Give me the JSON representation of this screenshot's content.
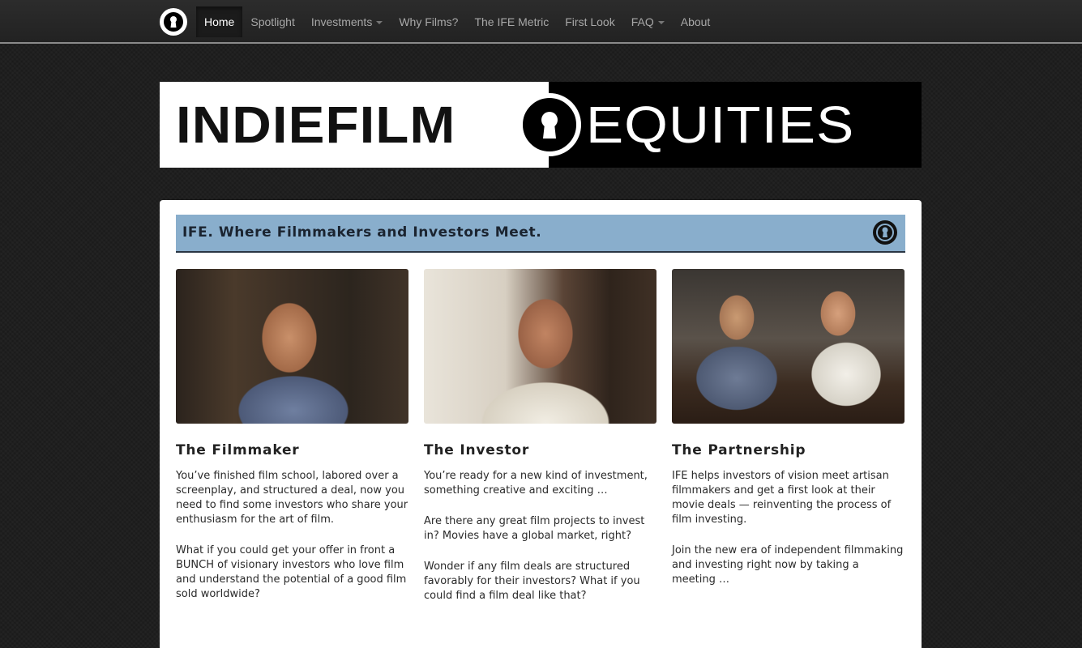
{
  "nav": {
    "brand_icon": "keyhole-icon",
    "items": [
      {
        "label": "Home",
        "active": true,
        "dropdown": false
      },
      {
        "label": "Spotlight",
        "active": false,
        "dropdown": false
      },
      {
        "label": "Investments",
        "active": false,
        "dropdown": true
      },
      {
        "label": "Why Films?",
        "active": false,
        "dropdown": false
      },
      {
        "label": "The IFE Metric",
        "active": false,
        "dropdown": false
      },
      {
        "label": "First Look",
        "active": false,
        "dropdown": false
      },
      {
        "label": "FAQ",
        "active": false,
        "dropdown": true
      },
      {
        "label": "About",
        "active": false,
        "dropdown": false
      }
    ]
  },
  "hero": {
    "left_word": "INDIEFILM",
    "right_word": "EQUITIES",
    "logo_icon": "keyhole-icon"
  },
  "tagline": {
    "text": "IFE. Where Filmmakers and Investors Meet.",
    "icon": "keyhole-icon",
    "bar_color": "#89aecc"
  },
  "columns": [
    {
      "heading": "The Filmmaker",
      "paragraphs": [
        "You’ve finished film school, labored over a screenplay, and structured a deal, now you need to find some investors who share your enthusiasm for the art of film.",
        "What if you could get your offer in front a BUNCH of visionary investors who love film and understand the potential of a good film sold worldwide?"
      ]
    },
    {
      "heading": "The Investor",
      "paragraphs": [
        "You’re ready for a new kind of investment, something creative and exciting …",
        "Are there any great film projects to invest in? Movies have a global market, right?",
        "Wonder if any film deals are structured favorably for their investors? What if you could find a film deal like that?"
      ]
    },
    {
      "heading": "The Partnership",
      "paragraphs": [
        "IFE helps investors of vision meet artisan filmmakers and get a first look at their movie deals — reinventing the process of film investing.",
        "Join the new era of independent filmmaking and investing right now by taking a meeting …"
      ]
    }
  ]
}
